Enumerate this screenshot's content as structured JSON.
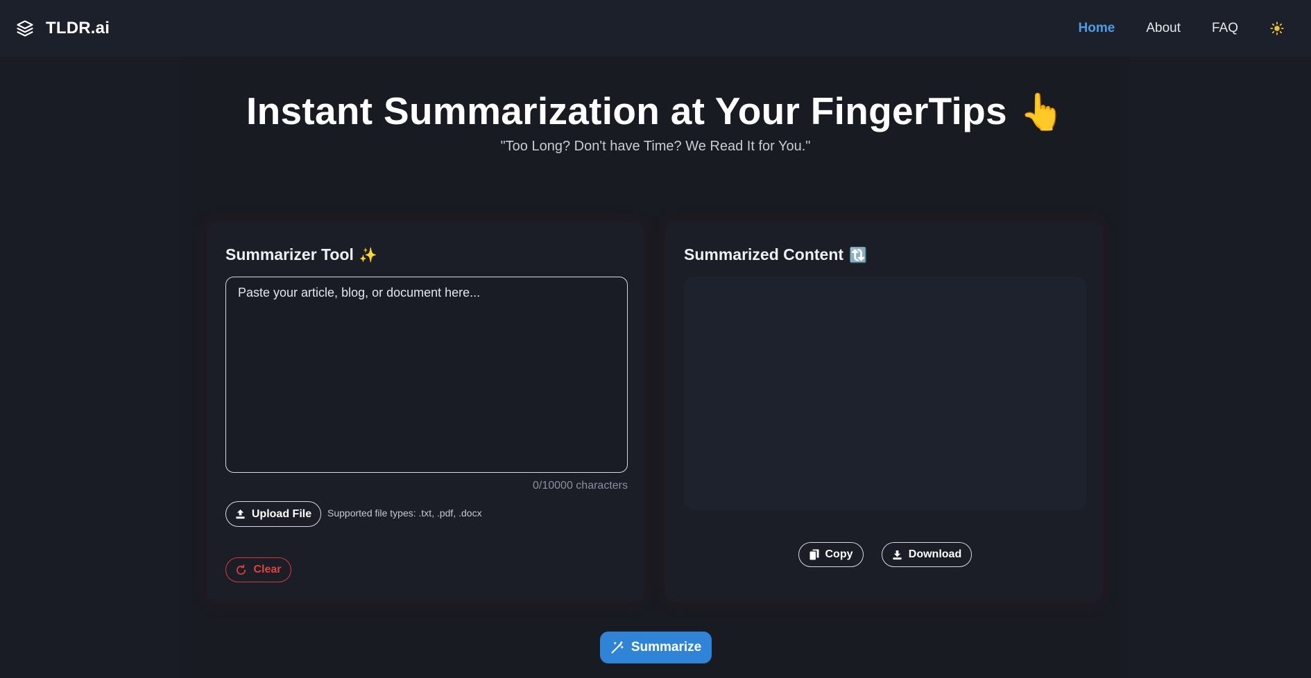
{
  "navbar": {
    "brand_name": "TLDR.ai",
    "logo_icon": "layers-icon",
    "links": [
      {
        "label": "Home",
        "active": true
      },
      {
        "label": "About",
        "active": false
      },
      {
        "label": "FAQ",
        "active": false
      }
    ],
    "theme_icon": "sun-icon"
  },
  "hero": {
    "title": "Instant Summarization at Your FingerTips",
    "title_emoji": "👆",
    "subtitle": "\"Too Long? Don't have Time? We Read It for You.\""
  },
  "summarizer": {
    "title": "Summarizer Tool",
    "title_emoji": "✨",
    "input_value": "",
    "input_placeholder": "Paste your article, blog, or document here...",
    "char_count": "0/10000 characters",
    "upload_label": "Upload File",
    "file_hint": "Supported file types: .txt, .pdf, .docx",
    "clear_label": "Clear"
  },
  "output": {
    "title": "Summarized Content",
    "title_emoji": "🔃",
    "content": "",
    "copy_label": "Copy",
    "download_label": "Download"
  },
  "summarize_label": "Summarize",
  "colors": {
    "background": "#191c24",
    "navbar": "#1c202a",
    "card": "#1b1e27",
    "accent": "#2f84d8",
    "active_link": "#4a9ee8",
    "danger": "#e0433c"
  }
}
